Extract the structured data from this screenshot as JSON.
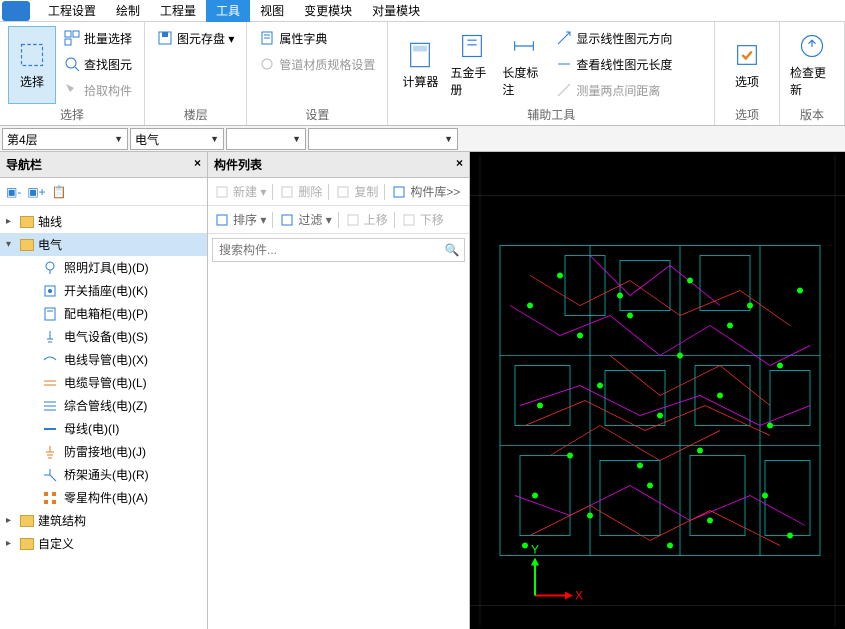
{
  "menu": {
    "items": [
      "工程设置",
      "绘制",
      "工程量",
      "工具",
      "视图",
      "变更模块",
      "对量模块"
    ],
    "active_index": 3
  },
  "ribbon": {
    "groups": [
      {
        "label": "选择",
        "big": [
          {
            "label": "选择"
          }
        ],
        "small": [
          {
            "label": "批量选择"
          },
          {
            "label": "查找图元"
          },
          {
            "label": "拾取构件",
            "disabled": true
          }
        ]
      },
      {
        "label": "楼层",
        "small": [
          {
            "label": "图元存盘 ▾"
          }
        ]
      },
      {
        "label": "设置",
        "small": [
          {
            "label": "属性字典"
          },
          {
            "label": "管道材质规格设置",
            "disabled": true
          }
        ]
      },
      {
        "label": "辅助工具",
        "big": [
          {
            "label": "计算器"
          },
          {
            "label": "五金手册"
          },
          {
            "label": "长度标注"
          }
        ],
        "small": [
          {
            "label": "显示线性图元方向"
          },
          {
            "label": "查看线性图元长度"
          },
          {
            "label": "测量两点间距离",
            "disabled": true
          }
        ]
      },
      {
        "label": "选项",
        "big": [
          {
            "label": "选项"
          }
        ]
      },
      {
        "label": "版本",
        "big": [
          {
            "label": "检查更新"
          }
        ]
      }
    ]
  },
  "filters": {
    "floor": "第4层",
    "category": "电气",
    "sub1": "",
    "sub2": ""
  },
  "nav": {
    "title": "导航栏",
    "roots": [
      {
        "label": "轴线",
        "expanded": false
      },
      {
        "label": "电气",
        "expanded": true,
        "selected": true,
        "children": [
          {
            "icon": "bulb",
            "label": "照明灯具(电)(D)"
          },
          {
            "icon": "switch",
            "label": "开关插座(电)(K)"
          },
          {
            "icon": "box",
            "label": "配电箱柜(电)(P)"
          },
          {
            "icon": "device",
            "label": "电气设备(电)(S)"
          },
          {
            "icon": "pipe",
            "label": "电线导管(电)(X)"
          },
          {
            "icon": "pipe2",
            "label": "电缆导管(电)(L)"
          },
          {
            "icon": "multi",
            "label": "综合管线(电)(Z)"
          },
          {
            "icon": "bus",
            "label": "母线(电)(I)"
          },
          {
            "icon": "ground",
            "label": "防雷接地(电)(J)"
          },
          {
            "icon": "joint",
            "label": "桥架通头(电)(R)"
          },
          {
            "icon": "misc",
            "label": "零星构件(电)(A)"
          }
        ]
      },
      {
        "label": "建筑结构",
        "expanded": false
      },
      {
        "label": "自定义",
        "expanded": false
      }
    ]
  },
  "componentList": {
    "title": "构件列表",
    "toolbar1": [
      {
        "label": "新建 ▾",
        "disabled": true
      },
      {
        "label": "删除",
        "disabled": true
      },
      {
        "label": "复制",
        "disabled": true
      },
      {
        "label": "构件库>>"
      }
    ],
    "toolbar2": [
      {
        "label": "排序 ▾"
      },
      {
        "label": "过滤 ▾"
      },
      {
        "label": "上移",
        "disabled": true
      },
      {
        "label": "下移",
        "disabled": true
      }
    ],
    "searchPlaceholder": "搜索构件..."
  },
  "axes": {
    "x": "X",
    "y": "Y"
  },
  "icons": {
    "select": "⬚",
    "batch": "▦",
    "find": "🔍",
    "pick": "↖",
    "save": "💾",
    "dict": "📋",
    "mat": "⚙",
    "calc": "🖩",
    "book": "📖",
    "dim": "↔",
    "dir": "↗",
    "len": "📏",
    "dist": "📐",
    "opt": "☑",
    "upd": "⟳",
    "close": "×",
    "expand": "▸",
    "collapse": "▾"
  }
}
